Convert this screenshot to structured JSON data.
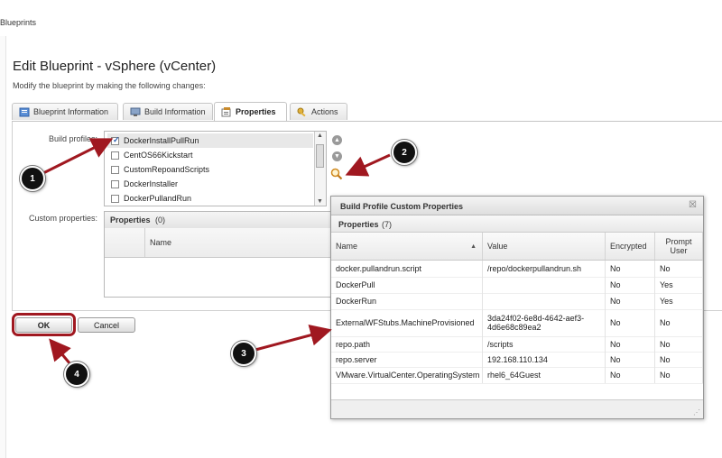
{
  "breadcrumb": "Blueprints",
  "page": {
    "title": "Edit Blueprint - vSphere (vCenter)",
    "subtitle": "Modify the blueprint by making the following changes:"
  },
  "tabs": [
    {
      "label": "Blueprint Information",
      "icon": "blueprint-icon"
    },
    {
      "label": "Build Information",
      "icon": "server-icon"
    },
    {
      "label": "Properties",
      "icon": "properties-icon",
      "active": true
    },
    {
      "label": "Actions",
      "icon": "key-icon"
    }
  ],
  "build_profiles": {
    "label": "Build profiles:",
    "items": [
      {
        "label": "DockerInstallPullRun",
        "checked": true
      },
      {
        "label": "CentOS66Kickstart",
        "checked": false
      },
      {
        "label": "CustomRepoandScripts",
        "checked": false
      },
      {
        "label": "DockerInstaller",
        "checked": false
      },
      {
        "label": "DockerPullandRun",
        "checked": false
      }
    ]
  },
  "custom_properties": {
    "label": "Custom properties:",
    "header": "Properties",
    "count": "(0)",
    "column_name": "Name"
  },
  "buttons": {
    "ok": "OK",
    "cancel": "Cancel"
  },
  "dialog": {
    "title": "Build Profile Custom Properties",
    "close": "☒",
    "subheader": "Properties",
    "count": "(7)",
    "columns": {
      "name": "Name",
      "sort": "▲",
      "value": "Value",
      "encrypted": "Encrypted",
      "prompt_user": "Prompt User"
    },
    "rows": [
      {
        "name": "docker.pullandrun.script",
        "value": "/repo/dockerpullandrun.sh",
        "encrypted": "No",
        "prompt": "No"
      },
      {
        "name": "DockerPull",
        "value": "",
        "encrypted": "No",
        "prompt": "Yes"
      },
      {
        "name": "DockerRun",
        "value": "",
        "encrypted": "No",
        "prompt": "Yes"
      },
      {
        "name": "ExternalWFStubs.MachineProvisioned",
        "value": "3da24f02-6e8d-4642-aef3-4d6e68c89ea2",
        "encrypted": "No",
        "prompt": "No"
      },
      {
        "name": "repo.path",
        "value": "/scripts",
        "encrypted": "No",
        "prompt": "No"
      },
      {
        "name": "repo.server",
        "value": "192.168.110.134",
        "encrypted": "No",
        "prompt": "No"
      },
      {
        "name": "VMware.VirtualCenter.OperatingSystem",
        "value": "rhel6_64Guest",
        "encrypted": "No",
        "prompt": "No"
      }
    ]
  },
  "callouts": [
    "1",
    "2",
    "3",
    "4"
  ],
  "colors": {
    "annotation_red": "#a01820",
    "tick_blue": "#2a5db0"
  }
}
